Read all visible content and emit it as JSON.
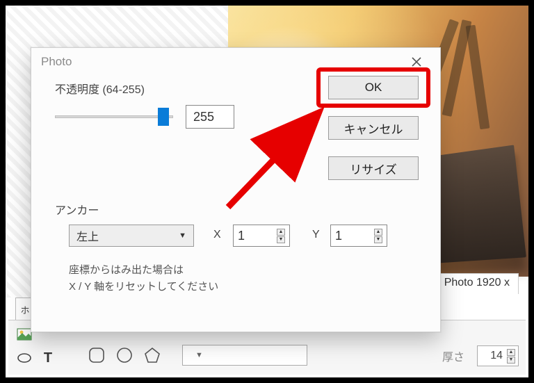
{
  "dialog": {
    "title": "Photo",
    "opacity_label": "不透明度 (64-255)",
    "opacity_value": "255",
    "ok_label": "OK",
    "cancel_label": "キャンセル",
    "resize_label": "リサイズ",
    "anchor_label": "アンカー",
    "anchor_value": "左上",
    "x_label": "X",
    "x_value": "1",
    "y_label": "Y",
    "y_value": "1",
    "note_line1": "座標からはみ出た場合は",
    "note_line2": "X / Y 軸をリセットしてください"
  },
  "background": {
    "status_label": "Photo 1920 x",
    "left_tab": "ホ"
  },
  "toolbar": {
    "thickness_label": "厚さ",
    "thickness_value": "14"
  }
}
